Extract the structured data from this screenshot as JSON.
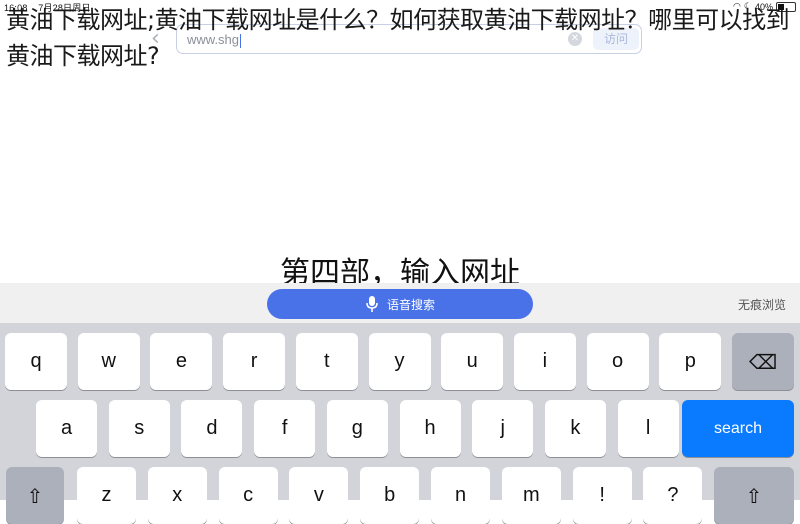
{
  "status_bar": {
    "time": "16:08",
    "date": "7月28日周日",
    "battery": "40%",
    "battery_level": 0.4
  },
  "address_bar": {
    "url": "www.shg",
    "visit_label": "访问"
  },
  "overlay_title": "黄油下载网址;黄油下载网址是什么？如何获取黄油下载网址？哪里可以找到黄油下载网址?",
  "caption": "第四部，输入网址",
  "toolbar": {
    "voice_search_label": "语音搜索",
    "incognito_label": "无痕浏览"
  },
  "keyboard": {
    "row1": [
      "q",
      "w",
      "e",
      "r",
      "t",
      "y",
      "u",
      "i",
      "o",
      "p"
    ],
    "row2": [
      "a",
      "s",
      "d",
      "f",
      "g",
      "h",
      "j",
      "k",
      "l"
    ],
    "row3": [
      "z",
      "x",
      "c",
      "v",
      "b",
      "n",
      "m",
      "!",
      "?"
    ],
    "search_label": "search",
    "colors": {
      "search": "#0a7bff",
      "voice": "#4a72e8"
    }
  }
}
